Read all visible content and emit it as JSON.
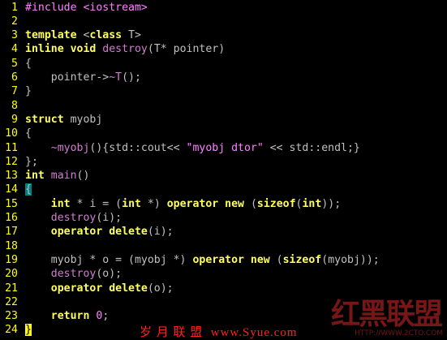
{
  "editor": {
    "lines": [
      {
        "n": "1",
        "tokens": [
          {
            "t": "#include <iostream>",
            "c": "pp"
          }
        ]
      },
      {
        "n": "2",
        "tokens": []
      },
      {
        "n": "3",
        "tokens": [
          {
            "t": "template",
            "c": "kw"
          },
          {
            "t": " <",
            "c": "plain"
          },
          {
            "t": "class",
            "c": "kw"
          },
          {
            "t": " T>",
            "c": "plain"
          }
        ]
      },
      {
        "n": "4",
        "tokens": [
          {
            "t": "inline void",
            "c": "kw"
          },
          {
            "t": " ",
            "c": "plain"
          },
          {
            "t": "destroy",
            "c": "fn"
          },
          {
            "t": "(T* pointer)",
            "c": "plain"
          }
        ]
      },
      {
        "n": "5",
        "tokens": [
          {
            "t": "{",
            "c": "brace"
          }
        ]
      },
      {
        "n": "6",
        "tokens": [
          {
            "t": "    pointer->",
            "c": "plain"
          },
          {
            "t": "~T",
            "c": "fn"
          },
          {
            "t": "();",
            "c": "plain"
          }
        ]
      },
      {
        "n": "7",
        "tokens": [
          {
            "t": "}",
            "c": "brace"
          }
        ]
      },
      {
        "n": "8",
        "tokens": []
      },
      {
        "n": "9",
        "tokens": [
          {
            "t": "struct",
            "c": "kw"
          },
          {
            "t": " myobj",
            "c": "plain"
          }
        ]
      },
      {
        "n": "10",
        "tokens": [
          {
            "t": "{",
            "c": "brace"
          }
        ]
      },
      {
        "n": "11",
        "tokens": [
          {
            "t": "    ",
            "c": "plain"
          },
          {
            "t": "~myobj",
            "c": "fn"
          },
          {
            "t": "(){std::cout<< ",
            "c": "plain"
          },
          {
            "t": "\"myobj dtor\"",
            "c": "str"
          },
          {
            "t": " << std::endl;}",
            "c": "plain"
          }
        ]
      },
      {
        "n": "12",
        "tokens": [
          {
            "t": "};",
            "c": "plain"
          }
        ]
      },
      {
        "n": "13",
        "tokens": [
          {
            "t": "int",
            "c": "kw"
          },
          {
            "t": " ",
            "c": "plain"
          },
          {
            "t": "main",
            "c": "fn"
          },
          {
            "t": "()",
            "c": "plain"
          }
        ]
      },
      {
        "n": "14",
        "tokens": [
          {
            "t": "{",
            "c": "bracehl"
          }
        ]
      },
      {
        "n": "15",
        "tokens": [
          {
            "t": "    ",
            "c": "plain"
          },
          {
            "t": "int",
            "c": "kw"
          },
          {
            "t": " * i = (",
            "c": "plain"
          },
          {
            "t": "int",
            "c": "kw"
          },
          {
            "t": " *) ",
            "c": "plain"
          },
          {
            "t": "operator new",
            "c": "kw"
          },
          {
            "t": " (",
            "c": "plain"
          },
          {
            "t": "sizeof",
            "c": "kw"
          },
          {
            "t": "(",
            "c": "plain"
          },
          {
            "t": "int",
            "c": "kw"
          },
          {
            "t": "));",
            "c": "plain"
          }
        ]
      },
      {
        "n": "16",
        "tokens": [
          {
            "t": "    ",
            "c": "plain"
          },
          {
            "t": "destroy",
            "c": "fn"
          },
          {
            "t": "(i);",
            "c": "plain"
          }
        ]
      },
      {
        "n": "17",
        "tokens": [
          {
            "t": "    ",
            "c": "plain"
          },
          {
            "t": "operator delete",
            "c": "kw"
          },
          {
            "t": "(i);",
            "c": "plain"
          }
        ]
      },
      {
        "n": "18",
        "tokens": []
      },
      {
        "n": "19",
        "tokens": [
          {
            "t": "    myobj * o = (myobj *) ",
            "c": "plain"
          },
          {
            "t": "operator new",
            "c": "kw"
          },
          {
            "t": " (",
            "c": "plain"
          },
          {
            "t": "sizeof",
            "c": "kw"
          },
          {
            "t": "(myobj));",
            "c": "plain"
          }
        ]
      },
      {
        "n": "20",
        "tokens": [
          {
            "t": "    ",
            "c": "plain"
          },
          {
            "t": "destroy",
            "c": "fn"
          },
          {
            "t": "(o);",
            "c": "plain"
          }
        ]
      },
      {
        "n": "21",
        "tokens": [
          {
            "t": "    ",
            "c": "plain"
          },
          {
            "t": "operator delete",
            "c": "kw"
          },
          {
            "t": "(o);",
            "c": "plain"
          }
        ]
      },
      {
        "n": "22",
        "tokens": []
      },
      {
        "n": "23",
        "tokens": [
          {
            "t": "    ",
            "c": "plain"
          },
          {
            "t": "return",
            "c": "kw"
          },
          {
            "t": " ",
            "c": "plain"
          },
          {
            "t": "0",
            "c": "num"
          },
          {
            "t": ";",
            "c": "plain"
          }
        ]
      },
      {
        "n": "24",
        "tokens": [
          {
            "t": "}",
            "c": "cursor"
          }
        ]
      }
    ]
  },
  "watermark": {
    "url_text": "岁 月 联 盟  www.Syue.com",
    "logo_chars": [
      "红",
      "黑",
      "联",
      "盟"
    ],
    "logo_sub": "HTTP://WWW.2CTO.COM"
  },
  "colors": {
    "background": "#000000",
    "line_number": "#ffff00",
    "keyword": "#ffff60",
    "preprocessor": "#ff80ff",
    "function": "#d27cd2",
    "string": "#ff80ff",
    "brace_highlight": "#008080",
    "cursor": "#ffff00",
    "watermark_url": "#ff2020",
    "watermark_logo": "#8b1a1a"
  }
}
